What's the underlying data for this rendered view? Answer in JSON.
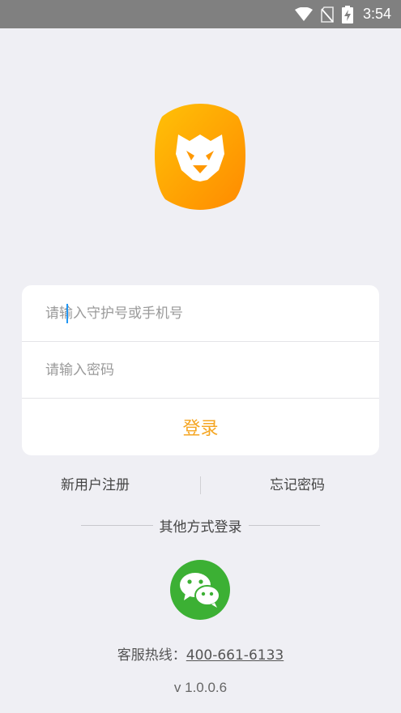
{
  "status_bar": {
    "time": "3:54",
    "icons": [
      "wifi-icon",
      "no-sim-icon",
      "battery-charging-icon"
    ]
  },
  "logo": {
    "icon": "lion-shield-logo",
    "colors": [
      "#ffb300",
      "#ff8c00"
    ]
  },
  "login_form": {
    "account_placeholder": "请输入守护号或手机号",
    "account_value": "",
    "password_placeholder": "请输入密码",
    "password_value": "",
    "login_label": "登录"
  },
  "links": {
    "register": "新用户注册",
    "forgot_password": "忘记密码"
  },
  "other_login": {
    "title": "其他方式登录",
    "wechat_icon": "wechat-icon"
  },
  "footer": {
    "hotline_label": "客服热线：",
    "hotline_number": "400-661-6133",
    "version": "v 1.0.0.6"
  },
  "colors": {
    "accent": "#f5a623",
    "wechat": "#3cb034",
    "background": "#efeff4",
    "status_bar": "#808080"
  }
}
